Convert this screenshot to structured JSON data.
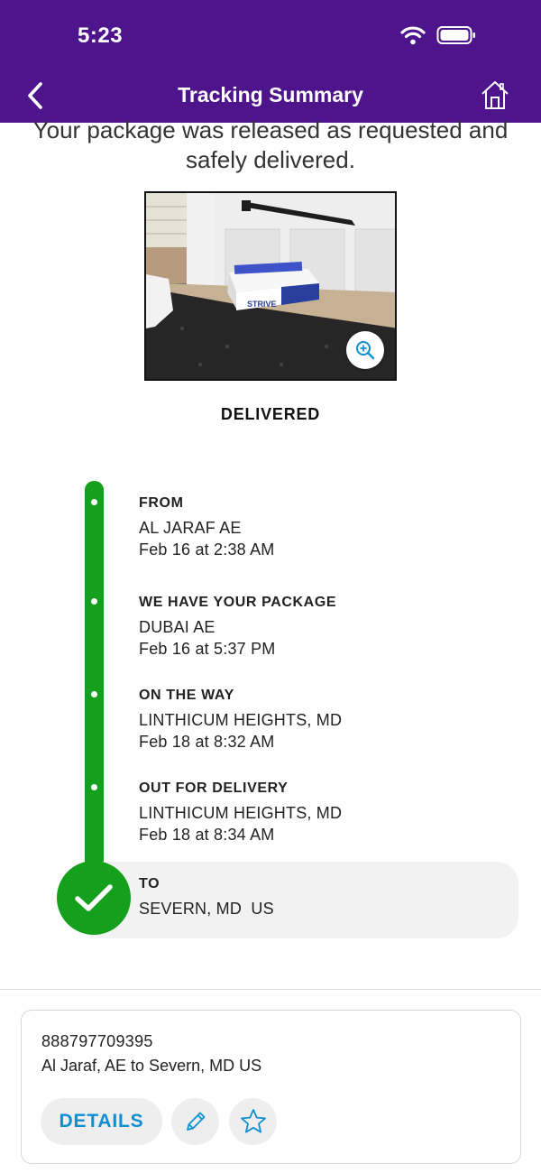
{
  "status_bar": {
    "time": "5:23",
    "icons": [
      "wifi-icon",
      "battery-icon"
    ]
  },
  "nav": {
    "title": "Tracking Summary",
    "back_icon": "chevron-left-icon",
    "home_icon": "home-icon"
  },
  "message": "Your package was released as requested and safely delivered.",
  "photo": {
    "box_text": "STRIVE",
    "zoom_icon": "zoom-in-icon"
  },
  "delivery_status": "DELIVERED",
  "timeline": [
    {
      "title": "FROM",
      "location": "AL JARAF AE",
      "time": "Feb 16 at 2:38 AM"
    },
    {
      "title": "WE HAVE YOUR PACKAGE",
      "location": "DUBAI AE",
      "time": "Feb 16 at 5:37 PM"
    },
    {
      "title": "ON THE WAY",
      "location": "LINTHICUM HEIGHTS, MD",
      "time": "Feb 18 at 8:32 AM"
    },
    {
      "title": "OUT FOR DELIVERY",
      "location": "LINTHICUM HEIGHTS, MD",
      "time": "Feb 18 at 8:34 AM"
    }
  ],
  "destination": {
    "title": "TO",
    "location": "SEVERN, MD  US",
    "icon": "checkmark-icon"
  },
  "shipment_card": {
    "tracking_number": "888797709395",
    "route": "Al Jaraf, AE to Severn, MD US",
    "details_label": "DETAILS",
    "edit_icon": "pencil-icon",
    "favorite_icon": "star-icon"
  },
  "colors": {
    "header": "#4d148c",
    "timeline_green": "#14a01d",
    "link_blue": "#0e8fd0"
  }
}
